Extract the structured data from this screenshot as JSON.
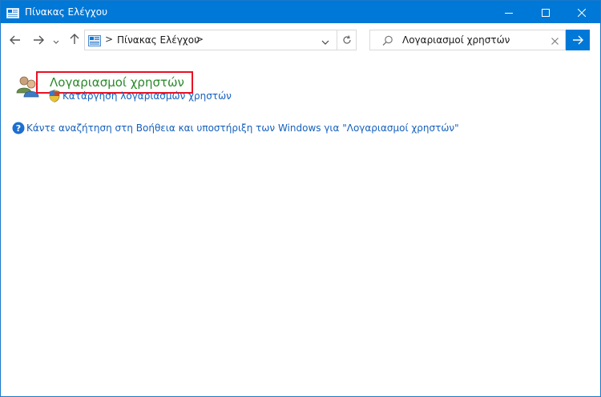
{
  "window": {
    "title": "Πίνακας Ελέγχου"
  },
  "nav": {
    "breadcrumb": "Πίνακας Ελέγχου",
    "separator": ">"
  },
  "search": {
    "value": "Λογαριασμοί χρηστών"
  },
  "results": {
    "title": "Λογαριασμοί χρηστών",
    "task": "Κατάργηση λογαριασμών χρηστών"
  },
  "help": {
    "text": "Κάντε αναζήτηση στη Βοήθεια και υποστήριξη των Windows για \"Λογαριασμοί χρηστών\""
  },
  "colors": {
    "titlebar": "#0078d7",
    "result_title": "#2a8a2a",
    "link": "#1560bd",
    "highlight": "#e81123"
  },
  "icons": [
    "control-panel-icon",
    "minimize-icon",
    "maximize-icon",
    "close-icon",
    "back-arrow-icon",
    "forward-arrow-icon",
    "chevron-down-icon",
    "up-arrow-icon",
    "refresh-icon",
    "search-icon",
    "clear-icon",
    "go-arrow-icon",
    "user-accounts-icon",
    "shield-icon",
    "help-icon"
  ]
}
